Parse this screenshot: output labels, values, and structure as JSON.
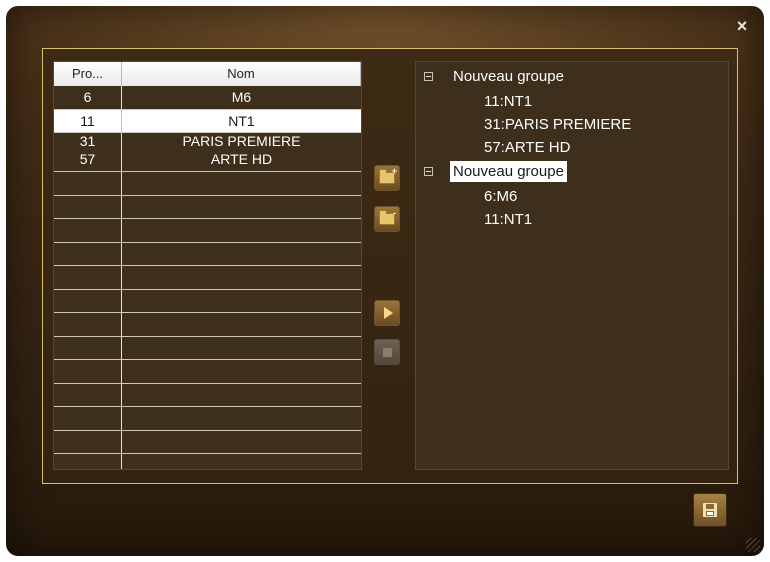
{
  "window": {
    "close_glyph": "×"
  },
  "table": {
    "columns": [
      "Pro...",
      "Nom"
    ],
    "rows": [
      {
        "num": "6",
        "name": "M6"
      },
      {
        "num": "11",
        "name": "NT1"
      },
      {
        "num": "31",
        "name": "PARIS PREMIERE"
      },
      {
        "num": "57",
        "name": "ARTE HD"
      }
    ],
    "selected_row": 1
  },
  "tree": {
    "groups": [
      {
        "label": "Nouveau groupe",
        "children": [
          "11:NT1",
          "31:PARIS PREMIERE",
          "57:ARTE HD"
        ]
      },
      {
        "label": "Nouveau groupe",
        "children": [
          "6:M6",
          "11:NT1"
        ]
      }
    ],
    "selected_group": 1
  },
  "buttons": {
    "add_group": "folder-add-icon",
    "remove_group": "folder-remove-icon",
    "add_to_group": "play-icon",
    "remove_from_group": "stop-icon",
    "save": "floppy-icon"
  },
  "colors": {
    "frame_border": "#d9bf6a",
    "background_dark": "#2e1f10",
    "list_background": "#3e2e1c",
    "selection": "#ffffff"
  }
}
